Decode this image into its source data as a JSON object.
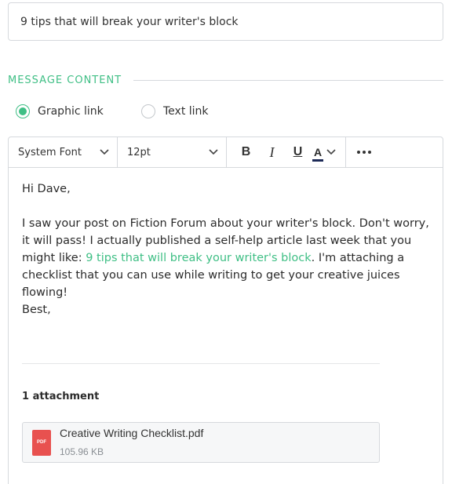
{
  "subject": {
    "value": "9 tips that will break your writer's block"
  },
  "section": {
    "title": "MESSAGE CONTENT"
  },
  "link_type": {
    "options": [
      {
        "label": "Graphic link",
        "selected": true
      },
      {
        "label": "Text link",
        "selected": false
      }
    ]
  },
  "toolbar": {
    "font": "System Font",
    "size": "12pt",
    "bold": "B",
    "italic": "I",
    "underline": "U",
    "color_letter": "A",
    "color_value": "#1d2a57",
    "more": "•••"
  },
  "message": {
    "greeting": "Hi Dave,",
    "para_before": "I saw your post on Fiction Forum about your writer's block. Don't worry, it will pass! I actually published a self-help article last week that you might like: ",
    "link_text": "9 tips that will break your writer's block",
    "para_after": ". I'm attaching a checklist that you can use while writing to get your creative juices flowing!",
    "closing": "Best,"
  },
  "attachments": {
    "title": "1 attachment",
    "files": [
      {
        "icon_label": "PDF",
        "name": "Creative Writing Checklist.pdf",
        "size": "105.96 KB"
      }
    ]
  },
  "colors": {
    "accent": "#3fbf85",
    "pdf": "#e8514f",
    "border": "#d6d9dd"
  }
}
